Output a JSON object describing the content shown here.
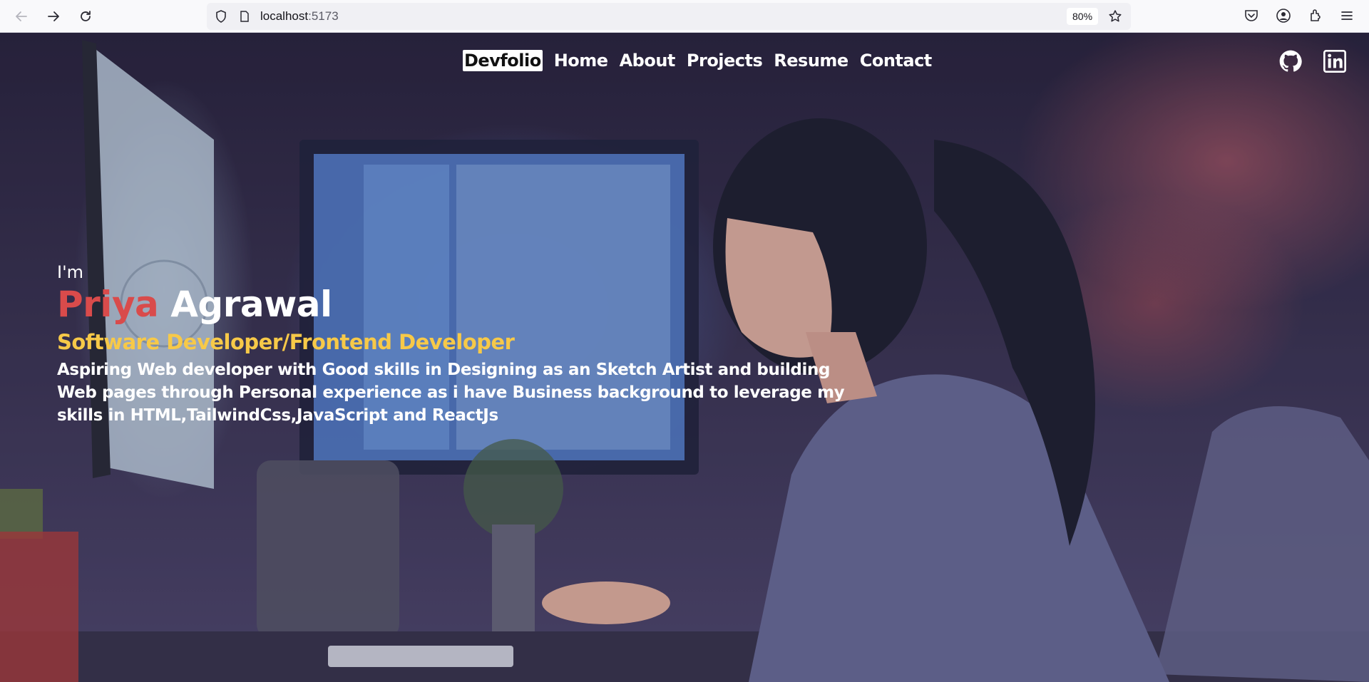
{
  "browser": {
    "url_host": "localhost",
    "url_port": ":5173",
    "zoom": "80%",
    "icons": [
      "back-icon",
      "forward-icon",
      "reload-icon",
      "shield-icon",
      "page-icon",
      "bookmark-star-icon",
      "pocket-icon",
      "account-icon",
      "extensions-icon",
      "menu-icon"
    ]
  },
  "nav": {
    "brand": "Devfolio",
    "links": [
      "Home",
      "About",
      "Projects",
      "Resume",
      "Contact"
    ]
  },
  "social": [
    "github-icon",
    "linkedin-icon"
  ],
  "hero": {
    "intro": "I'm",
    "first_name": "Priya",
    "last_name": "Agrawal",
    "role": "Software Developer/Frontend Developer",
    "bio": "Aspiring Web developer with Good skills in Designing as an Sketch Artist and building Web pages through Personal experience as i have Business background to leverage my skills in HTML,TailwindCss,JavaScript and ReactJs"
  },
  "colors": {
    "first_name": "#d94b4b",
    "role": "#f7c948",
    "chrome_bg": "#f9f9fb"
  }
}
